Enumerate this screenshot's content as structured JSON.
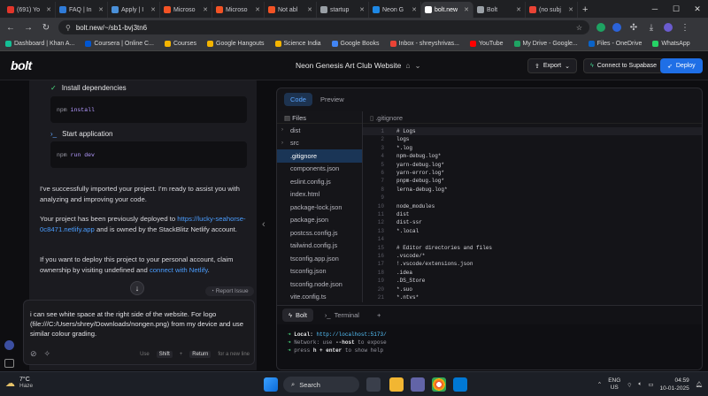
{
  "browser": {
    "tabs": [
      {
        "label": "(691) Yo",
        "color": "#e2352a",
        "active": false
      },
      {
        "label": "FAQ | In",
        "color": "#2f7bd8",
        "active": false
      },
      {
        "label": "Apply | I",
        "color": "#4a90d9",
        "active": false
      },
      {
        "label": "Microso",
        "color": "#f35325",
        "active": false
      },
      {
        "label": "Microso",
        "color": "#f35325",
        "active": false
      },
      {
        "label": "Not abl",
        "color": "#f35325",
        "active": false
      },
      {
        "label": "startup",
        "color": "#9aa0a6",
        "active": false
      },
      {
        "label": "Neon G",
        "color": "#1e88e5",
        "active": false
      },
      {
        "label": "bolt.new",
        "color": "#ffffff",
        "active": true
      },
      {
        "label": "Bolt",
        "color": "#9aa0a6",
        "active": false
      },
      {
        "label": "(no subj",
        "color": "#ea4335",
        "active": false
      }
    ],
    "new_tab": "+",
    "url": "bolt.new/~/sb1-bvj3tn6",
    "bookmarks": [
      {
        "label": "Dashboard | Khan A...",
        "color": "#14bf96"
      },
      {
        "label": "Coursera | Online C...",
        "color": "#0056d2"
      },
      {
        "label": "Courses",
        "color": "#f4b400"
      },
      {
        "label": "Google Hangouts",
        "color": "#f4b400"
      },
      {
        "label": "Science India",
        "color": "#f4b400"
      },
      {
        "label": "Google Books",
        "color": "#4285f4"
      },
      {
        "label": "Inbox - shreyshrivas...",
        "color": "#ea4335"
      },
      {
        "label": "YouTube",
        "color": "#ff0000"
      },
      {
        "label": "My Drive - Google...",
        "color": "#1fa463"
      },
      {
        "label": "Files - OneDrive",
        "color": "#0a63c9"
      },
      {
        "label": "WhatsApp",
        "color": "#25d366"
      }
    ]
  },
  "app": {
    "logo": "bolt",
    "project_title": "Neon Genesis Art Club Website",
    "export_label": "Export",
    "supabase_label": "Connect to Supabase",
    "deploy_label": "Deploy"
  },
  "chat": {
    "step1": "Install dependencies",
    "cmd1": {
      "main": "npm",
      "arg": "install"
    },
    "step2": "Start application",
    "cmd2": {
      "main": "npm",
      "arg": "run dev"
    },
    "para1": "I've successfully imported your project. I'm ready to assist you with analyzing and improving your code.",
    "para2_pre": "Your project has been previously deployed to ",
    "para2_link": "https://lucky-seahorse-0c8471.netlify.app",
    "para2_post": " and is owned by the StackBlitz Netlify account.",
    "para3_pre": "If you want to deploy this project to your personal account, claim ownership by visiting undefined and ",
    "para3_link": "connect with Netlify",
    "para3_post": ".",
    "report_label": "Report Issue",
    "prompt_text": "i can see white space at the right side of the website. For logo (file:///C:/Users/shrey/Downloads/nongen.png) from my device and use similar colour grading.",
    "hint_use": "Use",
    "hint_key1": "Shift",
    "hint_plus": "+",
    "hint_key2": "Return",
    "hint_tail": "for a new line"
  },
  "workbench": {
    "tab_code": "Code",
    "tab_preview": "Preview",
    "files_label": "Files",
    "files": [
      {
        "name": "dist",
        "type": "folder"
      },
      {
        "name": "src",
        "type": "folder"
      },
      {
        "name": ".gitignore",
        "type": "file",
        "selected": true
      },
      {
        "name": "components.json",
        "type": "file"
      },
      {
        "name": "eslint.config.js",
        "type": "file"
      },
      {
        "name": "index.html",
        "type": "file"
      },
      {
        "name": "package-lock.json",
        "type": "file"
      },
      {
        "name": "package.json",
        "type": "file"
      },
      {
        "name": "postcss.config.js",
        "type": "file"
      },
      {
        "name": "tailwind.config.js",
        "type": "file"
      },
      {
        "name": "tsconfig.app.json",
        "type": "file"
      },
      {
        "name": "tsconfig.json",
        "type": "file"
      },
      {
        "name": "tsconfig.node.json",
        "type": "file"
      },
      {
        "name": "vite.config.ts",
        "type": "file"
      }
    ],
    "open_file": ".gitignore",
    "code_lines": [
      "# Logs",
      "logs",
      "*.log",
      "npm-debug.log*",
      "yarn-debug.log*",
      "yarn-error.log*",
      "pnpm-debug.log*",
      "lerna-debug.log*",
      "",
      "node_modules",
      "dist",
      "dist-ssr",
      "*.local",
      "",
      "# Editor directories and files",
      ".vscode/*",
      "!.vscode/extensions.json",
      ".idea",
      ".DS_Store",
      "*.suo",
      "*.ntvs*"
    ],
    "line_numbers": [
      "1",
      "2",
      "3",
      "4",
      "5",
      "6",
      "7",
      "8",
      "9",
      "10",
      "11",
      "12",
      "13",
      "14",
      "15",
      "16",
      "17",
      "18",
      "19",
      "20",
      "21"
    ],
    "term_tab_bolt": "Bolt",
    "term_tab_terminal": "Terminal",
    "term_add": "+",
    "terminal": {
      "l1_label": "Local:",
      "l1_url": "http://localhost:5173/",
      "l2_label": "Network:",
      "l2_pre": "use",
      "l2_flag": "--host",
      "l2_post": "to expose",
      "l3_pre": "press",
      "l3_key": "h + enter",
      "l3_post": "to show help"
    }
  },
  "taskbar": {
    "temp": "7°C",
    "weather": "Haze",
    "search": "Search",
    "lang1": "ENG",
    "lang2": "US",
    "time": "04:59",
    "date": "10-01-2025"
  }
}
